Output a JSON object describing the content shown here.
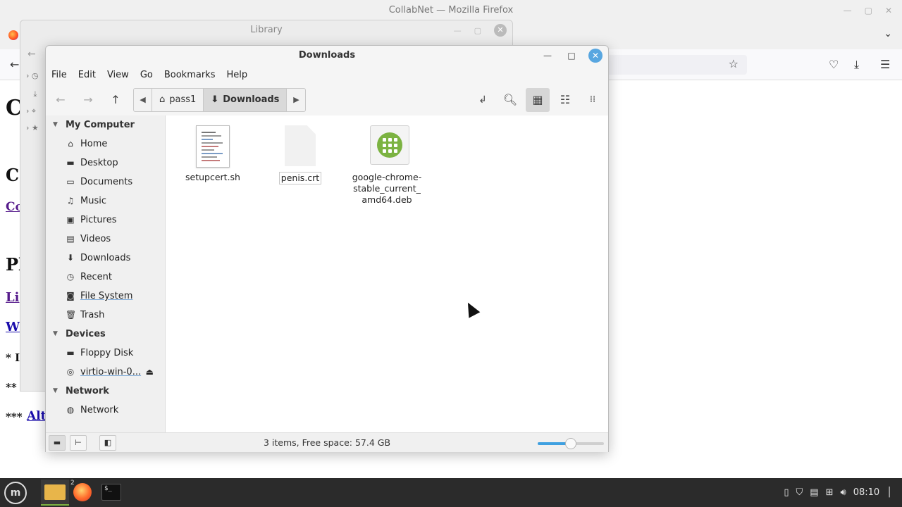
{
  "firefox": {
    "window_title": "CollabNet — Mozilla Firefox",
    "page_fragments": [
      "C",
      "C",
      "Co",
      "Pl",
      "Li",
      "W",
      "* I",
      "**",
      "***",
      "Alt"
    ]
  },
  "library": {
    "title": "Library"
  },
  "file_manager": {
    "title": "Downloads",
    "menu": [
      "File",
      "Edit",
      "View",
      "Go",
      "Bookmarks",
      "Help"
    ],
    "path": [
      "pass1",
      "Downloads"
    ],
    "sidebar": {
      "my_computer": {
        "label": "My Computer",
        "items": [
          {
            "label": "Home",
            "icon": "home-icon"
          },
          {
            "label": "Desktop",
            "icon": "desktop-icon"
          },
          {
            "label": "Documents",
            "icon": "documents-icon"
          },
          {
            "label": "Music",
            "icon": "music-icon"
          },
          {
            "label": "Pictures",
            "icon": "pictures-icon"
          },
          {
            "label": "Videos",
            "icon": "videos-icon"
          },
          {
            "label": "Downloads",
            "icon": "downloads-icon"
          },
          {
            "label": "Recent",
            "icon": "recent-icon"
          },
          {
            "label": "File System",
            "icon": "filesystem-icon"
          },
          {
            "label": "Trash",
            "icon": "trash-icon"
          }
        ]
      },
      "devices": {
        "label": "Devices",
        "items": [
          {
            "label": "Floppy Disk",
            "icon": "floppy-icon"
          },
          {
            "label": "virtio-win-0...",
            "icon": "disc-icon"
          }
        ]
      },
      "network": {
        "label": "Network",
        "items": [
          {
            "label": "Network",
            "icon": "network-icon"
          }
        ]
      }
    },
    "files": [
      {
        "name": "setupcert.sh",
        "type": "script"
      },
      {
        "name": "penis.crt",
        "type": "certificate"
      },
      {
        "name": "google-chrome-stable_current_amd64.deb",
        "name_lines": [
          "google-chrome-",
          "stable_current_",
          "amd64.deb"
        ],
        "type": "package"
      }
    ],
    "status": "3 items, Free space: 57.4 GB",
    "zoom_level_fraction": 0.5
  },
  "taskbar": {
    "firefox_window_count": "2",
    "terminal_label": "$_",
    "clock": "08:10"
  },
  "colors": {
    "accent": "#58a6e0",
    "zoom_fill": "#3fa0e0",
    "mint_green": "#7cb342"
  }
}
